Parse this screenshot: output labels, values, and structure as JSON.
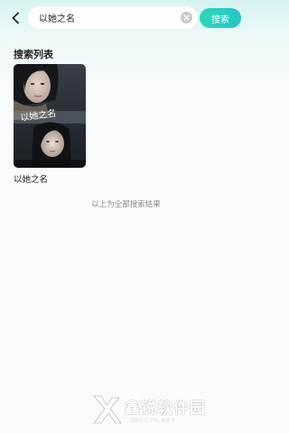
{
  "search": {
    "value": "以她之名",
    "button_label": "搜索"
  },
  "results": {
    "section_title": "搜索列表",
    "items": [
      {
        "title": "以她之名",
        "poster_text": "以她之名"
      }
    ],
    "end_note": "以上为全部搜索结果"
  },
  "watermark": {
    "brand": "鑫锐软件园",
    "site": "XRCCTV.NET"
  },
  "colors": {
    "accent": "#22c6c8",
    "background_top": "#d6f3f1"
  }
}
